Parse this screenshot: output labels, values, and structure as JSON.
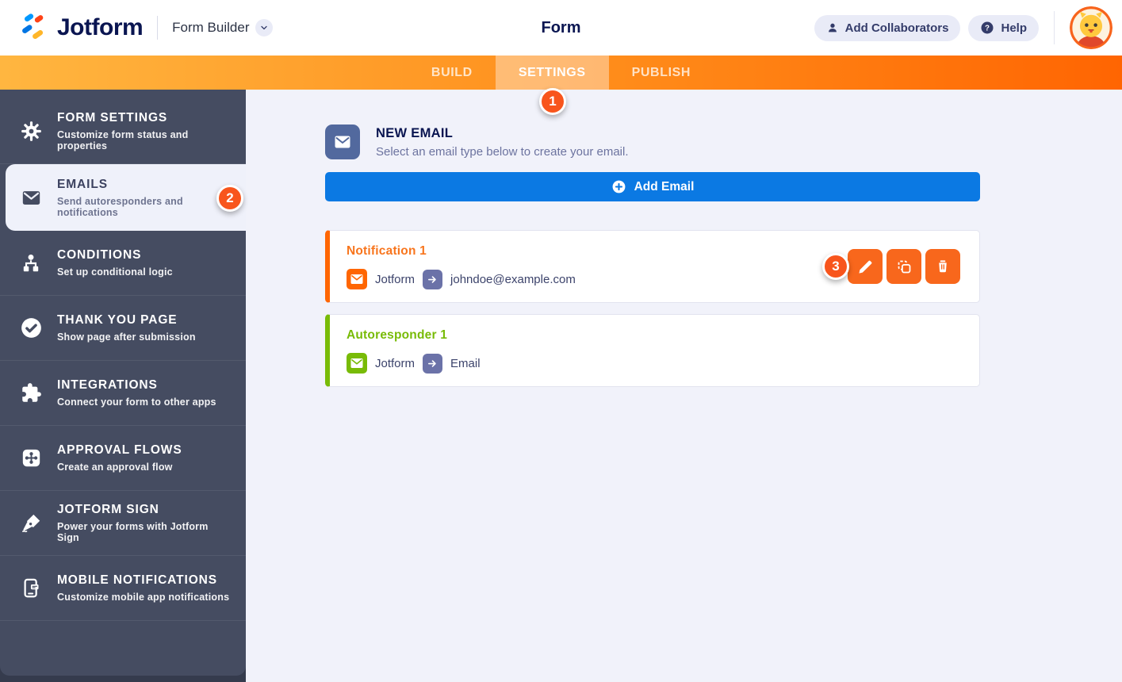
{
  "header": {
    "brand": "Jotform",
    "product": "Form Builder",
    "title": "Form",
    "add_collaborators_label": "Add Collaborators",
    "help_label": "Help"
  },
  "nav": {
    "tabs": [
      {
        "label": "BUILD",
        "active": false
      },
      {
        "label": "SETTINGS",
        "active": true
      },
      {
        "label": "PUBLISH",
        "active": false
      }
    ]
  },
  "badges": {
    "step1": "1",
    "step2": "2",
    "step3": "3"
  },
  "sidebar": {
    "items": [
      {
        "label": "FORM SETTINGS",
        "desc": "Customize form status and properties",
        "icon": "gear-icon",
        "active": false
      },
      {
        "label": "EMAILS",
        "desc": "Send autoresponders and notifications",
        "icon": "envelope-icon",
        "active": true,
        "badge": "2"
      },
      {
        "label": "CONDITIONS",
        "desc": "Set up conditional logic",
        "icon": "conditions-tree-icon",
        "active": false
      },
      {
        "label": "THANK YOU PAGE",
        "desc": "Show page after submission",
        "icon": "check-circle-icon",
        "active": false
      },
      {
        "label": "INTEGRATIONS",
        "desc": "Connect your form to other apps",
        "icon": "puzzle-icon",
        "active": false
      },
      {
        "label": "APPROVAL FLOWS",
        "desc": "Create an approval flow",
        "icon": "approval-flow-icon",
        "active": false
      },
      {
        "label": "JOTFORM SIGN",
        "desc": "Power your forms with Jotform Sign",
        "icon": "pen-icon",
        "active": false
      },
      {
        "label": "MOBILE NOTIFICATIONS",
        "desc": "Customize mobile app notifications",
        "icon": "mobile-phone-icon",
        "active": false
      }
    ]
  },
  "main": {
    "new_email": {
      "title": "NEW EMAIL",
      "subtitle": "Select an email type below to create your email.",
      "icon": "envelope-icon"
    },
    "add_email_label": "Add Email",
    "emails": [
      {
        "name": "Notification 1",
        "from": "Jotform",
        "to": "johndoe@example.com",
        "accent": "#ff6602",
        "actions": [
          "edit",
          "duplicate",
          "delete"
        ],
        "badge": "3"
      },
      {
        "name": "Autoresponder 1",
        "from": "Jotform",
        "to": "Email",
        "accent": "#78bb07",
        "actions": []
      }
    ]
  },
  "colors": {
    "navy": "#0a1551",
    "nav_gradient_start": "#ffb640",
    "nav_gradient_end": "#ff6502",
    "badge_orange": "#f8551c",
    "accent_orange": "#ff6602",
    "action_orange": "#f8671c",
    "accent_green": "#78bb07",
    "button_blue": "#0b79e3",
    "steel_blue": "#52699e",
    "arrow_chip": "#6b72a8",
    "sidebar_bg": "#454c61",
    "sidebar_active_bg": "#eff1fa",
    "content_bg": "#f1f2fa"
  }
}
